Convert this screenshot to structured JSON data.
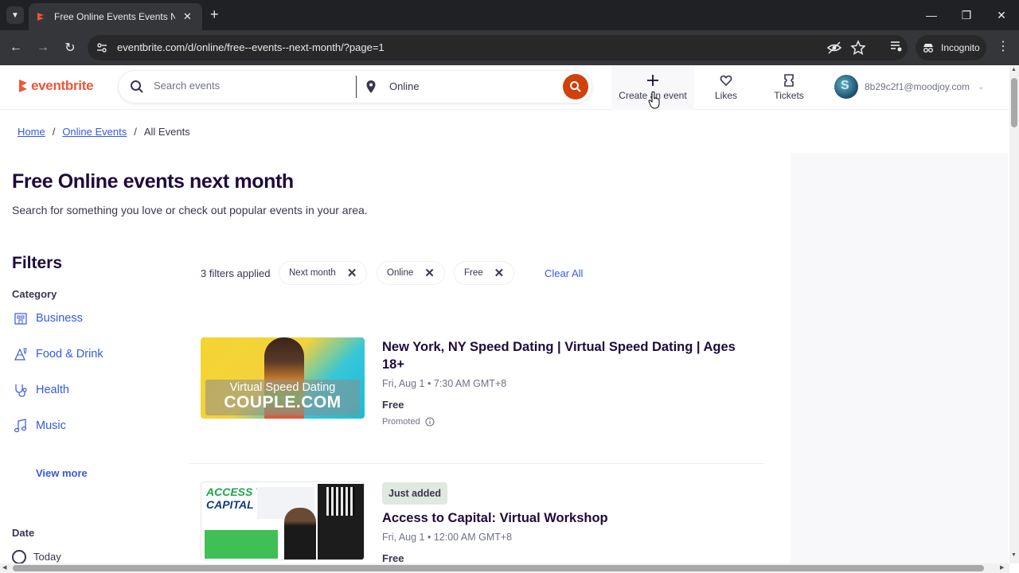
{
  "browser": {
    "tab_title": "Free Online Events Events Next Month",
    "url": "eventbrite.com/d/online/free--events--next-month/?page=1",
    "incognito_label": "Incognito"
  },
  "header": {
    "logo_text": "eventbrite",
    "search_placeholder": "Search events",
    "location": "Online",
    "create_label": "Create an event",
    "likes_label": "Likes",
    "tickets_label": "Tickets",
    "account_email": "8b29c2f1@moodjoy.com"
  },
  "breadcrumb": [
    {
      "label": "Home"
    },
    {
      "label": "Online Events"
    },
    {
      "label": "All Events"
    }
  ],
  "page": {
    "title": "Free Online events next month",
    "subtitle": "Search for something you love or check out popular events in your area."
  },
  "filters": {
    "title": "Filters",
    "category_title": "Category",
    "categories": [
      {
        "label": "Business",
        "icon": "building-icon"
      },
      {
        "label": "Food & Drink",
        "icon": "food-drink-icon"
      },
      {
        "label": "Health",
        "icon": "stethoscope-icon"
      },
      {
        "label": "Music",
        "icon": "music-note-icon"
      }
    ],
    "view_more": "View more",
    "date_title": "Date",
    "date_options": [
      {
        "label": "Today"
      }
    ]
  },
  "applied_filters": {
    "count_label": "3 filters applied",
    "chips": [
      {
        "label": "Next month"
      },
      {
        "label": "Online"
      },
      {
        "label": "Free"
      }
    ],
    "clear_all": "Clear All"
  },
  "events": [
    {
      "title": "New York, NY Speed Dating | Virtual Speed Dating | Ages 18+",
      "date": "Fri, Aug 1 • 7:30 AM GMT+8",
      "price": "Free",
      "promoted": "Promoted",
      "image_text": [
        "Virtual Speed Dating",
        "COUPLE.COM"
      ]
    },
    {
      "badge": "Just added",
      "title": "Access to Capital: Virtual Workshop",
      "date": "Fri, Aug 1 • 12:00 AM GMT+8",
      "price": "Free",
      "image_text": [
        "ACCESS TO",
        "CAPITAL"
      ]
    }
  ],
  "colors": {
    "brand": "#f05537",
    "link": "#3659e3",
    "search_button": "#d1410c",
    "text_primary": "#1e0a3c"
  }
}
